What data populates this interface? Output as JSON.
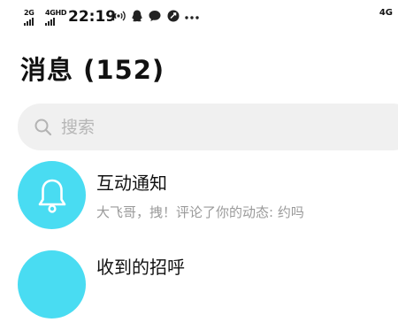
{
  "status_bar": {
    "sim1": "2G",
    "sim2": "4GHD",
    "time": "22:19",
    "right_indicator": "4G",
    "icons": [
      "hotspot-icon",
      "qq-icon",
      "chat-icon",
      "app-icon",
      "more-dots-icon"
    ]
  },
  "header": {
    "title": "消息 (152)"
  },
  "search": {
    "placeholder": "搜索"
  },
  "messages": [
    {
      "title": "互动通知",
      "subtitle": "大飞哥，拽！评论了你的动态: 约吗",
      "icon": "bell-icon"
    },
    {
      "title": "收到的招呼",
      "subtitle": "",
      "icon": "wave-icon"
    }
  ],
  "colors": {
    "avatar": "#49dcf2",
    "search_bg": "#f0f0f0",
    "subtitle": "#9a9a9a"
  }
}
